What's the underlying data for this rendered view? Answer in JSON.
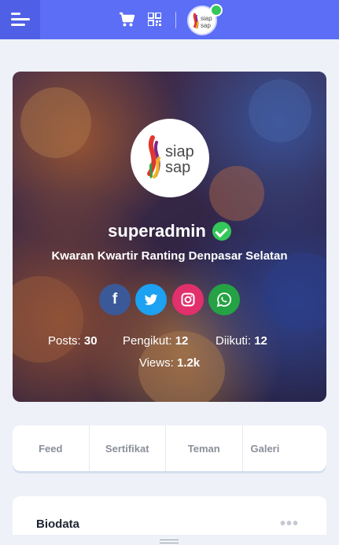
{
  "topbar": {
    "logo_text": "siap sap",
    "colors": {
      "bar": "#5b6ef5",
      "menu": "#4f60e6"
    },
    "icons": [
      "menu-icon",
      "cart-icon",
      "qr-icon",
      "verified-icon"
    ]
  },
  "profile": {
    "username": "superadmin",
    "organization": "Kwaran Kwartir Ranting Denpasar Selatan",
    "logo_text": "siap sap",
    "socials": [
      {
        "name": "facebook",
        "glyph": "f"
      },
      {
        "name": "twitter",
        "glyph": "t"
      },
      {
        "name": "instagram",
        "glyph": "◎"
      },
      {
        "name": "whatsapp",
        "glyph": "✆"
      }
    ],
    "stats": {
      "posts_label": "Posts:",
      "posts_value": "30",
      "followers_label": "Pengikut:",
      "followers_value": "12",
      "following_label": "Diikuti:",
      "following_value": "12",
      "views_label": "Views:",
      "views_value": "1.2k"
    }
  },
  "tabs": [
    "Feed",
    "Sertifikat",
    "Teman",
    "Galeri"
  ],
  "biodata": {
    "title": "Biodata",
    "more": "•••"
  }
}
